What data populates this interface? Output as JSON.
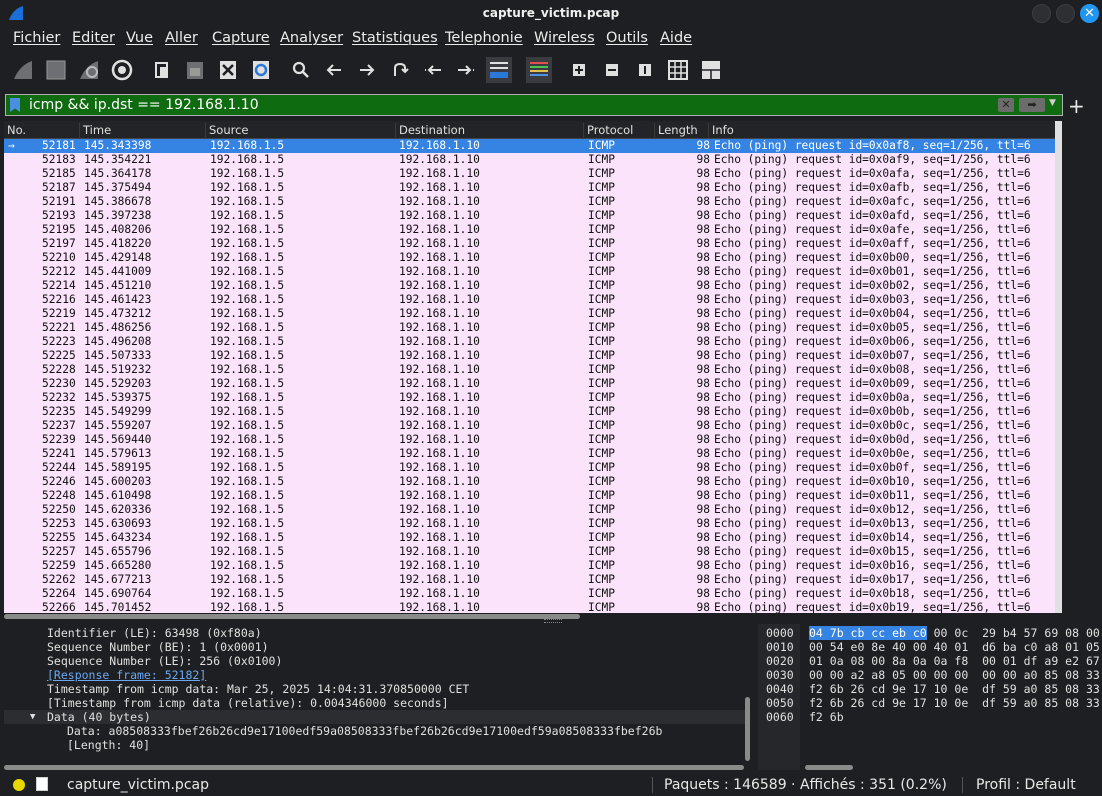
{
  "window": {
    "title": "capture_victim.pcap"
  },
  "menu": [
    "Fichier",
    "Editer",
    "Vue",
    "Aller",
    "Capture",
    "Analyser",
    "Statistiques",
    "Telephonie",
    "Wireless",
    "Outils",
    "Aide"
  ],
  "filter": {
    "value": "icmp && ip.dst == 192.168.1.10"
  },
  "packet_list": {
    "columns": [
      "No.",
      "Time",
      "Source",
      "Destination",
      "Protocol",
      "Length",
      "Info"
    ],
    "rows": [
      [
        "52181",
        "145.343398",
        "192.168.1.5",
        "192.168.1.10",
        "ICMP",
        "98",
        "Echo (ping) request  id=0x0af8, seq=1/256, ttl=6"
      ],
      [
        "52183",
        "145.354221",
        "192.168.1.5",
        "192.168.1.10",
        "ICMP",
        "98",
        "Echo (ping) request  id=0x0af9, seq=1/256, ttl=6"
      ],
      [
        "52185",
        "145.364178",
        "192.168.1.5",
        "192.168.1.10",
        "ICMP",
        "98",
        "Echo (ping) request  id=0x0afa, seq=1/256, ttl=6"
      ],
      [
        "52187",
        "145.375494",
        "192.168.1.5",
        "192.168.1.10",
        "ICMP",
        "98",
        "Echo (ping) request  id=0x0afb, seq=1/256, ttl=6"
      ],
      [
        "52191",
        "145.386678",
        "192.168.1.5",
        "192.168.1.10",
        "ICMP",
        "98",
        "Echo (ping) request  id=0x0afc, seq=1/256, ttl=6"
      ],
      [
        "52193",
        "145.397238",
        "192.168.1.5",
        "192.168.1.10",
        "ICMP",
        "98",
        "Echo (ping) request  id=0x0afd, seq=1/256, ttl=6"
      ],
      [
        "52195",
        "145.408206",
        "192.168.1.5",
        "192.168.1.10",
        "ICMP",
        "98",
        "Echo (ping) request  id=0x0afe, seq=1/256, ttl=6"
      ],
      [
        "52197",
        "145.418220",
        "192.168.1.5",
        "192.168.1.10",
        "ICMP",
        "98",
        "Echo (ping) request  id=0x0aff, seq=1/256, ttl=6"
      ],
      [
        "52210",
        "145.429148",
        "192.168.1.5",
        "192.168.1.10",
        "ICMP",
        "98",
        "Echo (ping) request  id=0x0b00, seq=1/256, ttl=6"
      ],
      [
        "52212",
        "145.441009",
        "192.168.1.5",
        "192.168.1.10",
        "ICMP",
        "98",
        "Echo (ping) request  id=0x0b01, seq=1/256, ttl=6"
      ],
      [
        "52214",
        "145.451210",
        "192.168.1.5",
        "192.168.1.10",
        "ICMP",
        "98",
        "Echo (ping) request  id=0x0b02, seq=1/256, ttl=6"
      ],
      [
        "52216",
        "145.461423",
        "192.168.1.5",
        "192.168.1.10",
        "ICMP",
        "98",
        "Echo (ping) request  id=0x0b03, seq=1/256, ttl=6"
      ],
      [
        "52219",
        "145.473212",
        "192.168.1.5",
        "192.168.1.10",
        "ICMP",
        "98",
        "Echo (ping) request  id=0x0b04, seq=1/256, ttl=6"
      ],
      [
        "52221",
        "145.486256",
        "192.168.1.5",
        "192.168.1.10",
        "ICMP",
        "98",
        "Echo (ping) request  id=0x0b05, seq=1/256, ttl=6"
      ],
      [
        "52223",
        "145.496208",
        "192.168.1.5",
        "192.168.1.10",
        "ICMP",
        "98",
        "Echo (ping) request  id=0x0b06, seq=1/256, ttl=6"
      ],
      [
        "52225",
        "145.507333",
        "192.168.1.5",
        "192.168.1.10",
        "ICMP",
        "98",
        "Echo (ping) request  id=0x0b07, seq=1/256, ttl=6"
      ],
      [
        "52228",
        "145.519232",
        "192.168.1.5",
        "192.168.1.10",
        "ICMP",
        "98",
        "Echo (ping) request  id=0x0b08, seq=1/256, ttl=6"
      ],
      [
        "52230",
        "145.529203",
        "192.168.1.5",
        "192.168.1.10",
        "ICMP",
        "98",
        "Echo (ping) request  id=0x0b09, seq=1/256, ttl=6"
      ],
      [
        "52232",
        "145.539375",
        "192.168.1.5",
        "192.168.1.10",
        "ICMP",
        "98",
        "Echo (ping) request  id=0x0b0a, seq=1/256, ttl=6"
      ],
      [
        "52235",
        "145.549299",
        "192.168.1.5",
        "192.168.1.10",
        "ICMP",
        "98",
        "Echo (ping) request  id=0x0b0b, seq=1/256, ttl=6"
      ],
      [
        "52237",
        "145.559207",
        "192.168.1.5",
        "192.168.1.10",
        "ICMP",
        "98",
        "Echo (ping) request  id=0x0b0c, seq=1/256, ttl=6"
      ],
      [
        "52239",
        "145.569440",
        "192.168.1.5",
        "192.168.1.10",
        "ICMP",
        "98",
        "Echo (ping) request  id=0x0b0d, seq=1/256, ttl=6"
      ],
      [
        "52241",
        "145.579613",
        "192.168.1.5",
        "192.168.1.10",
        "ICMP",
        "98",
        "Echo (ping) request  id=0x0b0e, seq=1/256, ttl=6"
      ],
      [
        "52244",
        "145.589195",
        "192.168.1.5",
        "192.168.1.10",
        "ICMP",
        "98",
        "Echo (ping) request  id=0x0b0f, seq=1/256, ttl=6"
      ],
      [
        "52246",
        "145.600203",
        "192.168.1.5",
        "192.168.1.10",
        "ICMP",
        "98",
        "Echo (ping) request  id=0x0b10, seq=1/256, ttl=6"
      ],
      [
        "52248",
        "145.610498",
        "192.168.1.5",
        "192.168.1.10",
        "ICMP",
        "98",
        "Echo (ping) request  id=0x0b11, seq=1/256, ttl=6"
      ],
      [
        "52250",
        "145.620336",
        "192.168.1.5",
        "192.168.1.10",
        "ICMP",
        "98",
        "Echo (ping) request  id=0x0b12, seq=1/256, ttl=6"
      ],
      [
        "52253",
        "145.630693",
        "192.168.1.5",
        "192.168.1.10",
        "ICMP",
        "98",
        "Echo (ping) request  id=0x0b13, seq=1/256, ttl=6"
      ],
      [
        "52255",
        "145.643234",
        "192.168.1.5",
        "192.168.1.10",
        "ICMP",
        "98",
        "Echo (ping) request  id=0x0b14, seq=1/256, ttl=6"
      ],
      [
        "52257",
        "145.655796",
        "192.168.1.5",
        "192.168.1.10",
        "ICMP",
        "98",
        "Echo (ping) request  id=0x0b15, seq=1/256, ttl=6"
      ],
      [
        "52259",
        "145.665280",
        "192.168.1.5",
        "192.168.1.10",
        "ICMP",
        "98",
        "Echo (ping) request  id=0x0b16, seq=1/256, ttl=6"
      ],
      [
        "52262",
        "145.677213",
        "192.168.1.5",
        "192.168.1.10",
        "ICMP",
        "98",
        "Echo (ping) request  id=0x0b17, seq=1/256, ttl=6"
      ],
      [
        "52264",
        "145.690764",
        "192.168.1.5",
        "192.168.1.10",
        "ICMP",
        "98",
        "Echo (ping) request  id=0x0b18, seq=1/256, ttl=6"
      ],
      [
        "52266",
        "145.701452",
        "192.168.1.5",
        "192.168.1.10",
        "ICMP",
        "98",
        "Echo (ping) request  id=0x0b19, seq=1/256, ttl=6"
      ]
    ],
    "selected_row_marker": "→"
  },
  "details": {
    "identifier_le": "Identifier (LE): 63498 (0xf80a)",
    "seq_be": "Sequence Number (BE): 1 (0x0001)",
    "seq_le": "Sequence Number (LE): 256 (0x0100)",
    "response_frame": "[Response frame: 52182]",
    "timestamp": "Timestamp from icmp data: Mar 25, 2025 14:04:31.370850000 CET",
    "timestamp_rel": "[Timestamp from icmp data (relative): 0.004346000 seconds]",
    "data_header": "Data (40 bytes)",
    "data_value": "Data: a08508333fbef26b26cd9e17100edf59a08508333fbef26b26cd9e17100edf59a08508333fbef26b",
    "data_length": "[Length: 40]",
    "expander": "▼"
  },
  "bytes": {
    "offsets": [
      "0000",
      "0010",
      "0020",
      "0030",
      "0040",
      "0050",
      "0060"
    ],
    "first_hl": "04 7b cb cc eb c0",
    "first_rest": " 00 0c  29 b4 57 69 08 00",
    "lines": [
      "00 54 e0 8e 40 00 40 01  d6 ba c0 a8 01 05",
      "01 0a 08 00 8a 0a 0a f8  00 01 df a9 e2 67",
      "00 00 a2 a8 05 00 00 00  00 00 a0 85 08 33",
      "f2 6b 26 cd 9e 17 10 0e  df 59 a0 85 08 33",
      "f2 6b 26 cd 9e 17 10 0e  df 59 a0 85 08 33",
      "f2 6b"
    ]
  },
  "status": {
    "file": "capture_victim.pcap",
    "packets": "Paquets : 146589 · Affichés : 351 (0.2%)",
    "profile": "Profil : Default"
  },
  "colors": {
    "row_bg": "#fbe3fb",
    "selected_bg": "#3584e4",
    "filter_bg": "#0f6b0f",
    "close_btn": "#2196f3"
  }
}
